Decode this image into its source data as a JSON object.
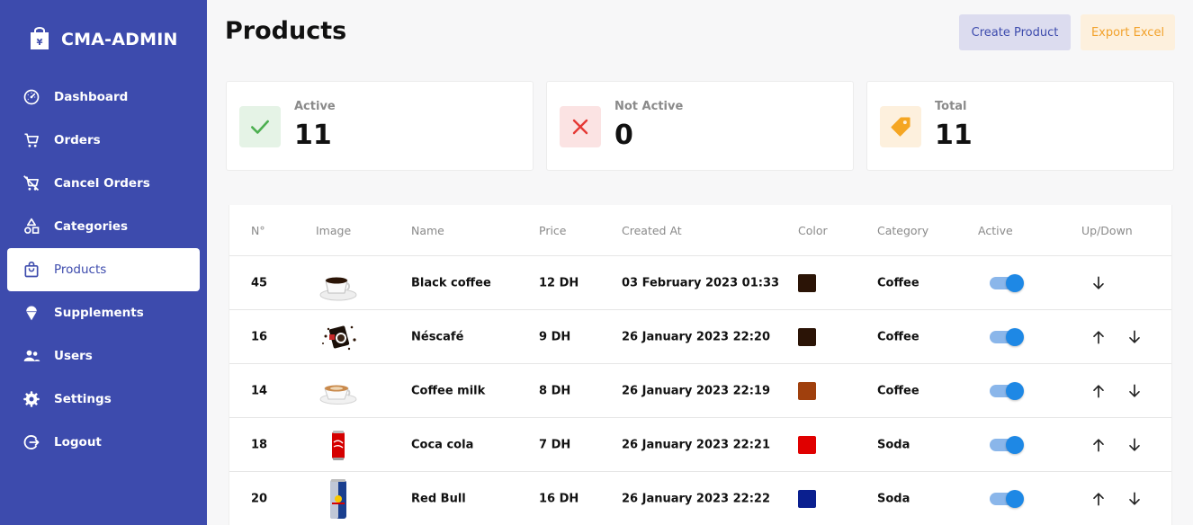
{
  "brand": {
    "name": "CMA-ADMIN",
    "logo_icon": "shopping-bag-yen-icon"
  },
  "sidebar": {
    "items": [
      {
        "label": "Dashboard",
        "icon": "speedometer-icon",
        "active": false
      },
      {
        "label": "Orders",
        "icon": "cart-icon",
        "active": false
      },
      {
        "label": "Cancel Orders",
        "icon": "cart-off-icon",
        "active": false
      },
      {
        "label": "Categories",
        "icon": "shapes-icon",
        "active": false
      },
      {
        "label": "Products",
        "icon": "shopping-bag-icon",
        "active": true
      },
      {
        "label": "Supplements",
        "icon": "ice-cream-icon",
        "active": false
      },
      {
        "label": "Users",
        "icon": "users-icon",
        "active": false
      },
      {
        "label": "Settings",
        "icon": "gear-icon",
        "active": false
      },
      {
        "label": "Logout",
        "icon": "logout-icon",
        "active": false
      }
    ]
  },
  "header": {
    "title": "Products",
    "create_label": "Create Product",
    "export_label": "Export Excel"
  },
  "stats": [
    {
      "label": "Active",
      "value": "11",
      "icon": "check-icon",
      "color": "#4caf50",
      "bg": "#e5f3e6"
    },
    {
      "label": "Not Active",
      "value": "0",
      "icon": "close-icon",
      "color": "#e53935",
      "bg": "#fbe3e3"
    },
    {
      "label": "Total",
      "value": "11",
      "icon": "price-tag-icon",
      "color": "#f5a623",
      "bg": "#fdf0dd"
    }
  ],
  "table": {
    "headers": [
      "N°",
      "Image",
      "Name",
      "Price",
      "Created At",
      "Color",
      "Category",
      "Active",
      "Up/Down"
    ],
    "rows": [
      {
        "no": "45",
        "image": "black-coffee-image",
        "name": "Black coffee",
        "price": "12 DH",
        "created": "03 February 2023 01:33",
        "color": "#2b1406",
        "category": "Coffee",
        "active": true,
        "up": false,
        "down": true
      },
      {
        "no": "16",
        "image": "nescafe-image",
        "name": "Néscafé",
        "price": "9 DH",
        "created": "26 January 2023 22:20",
        "color": "#2b1406",
        "category": "Coffee",
        "active": true,
        "up": true,
        "down": true
      },
      {
        "no": "14",
        "image": "coffee-milk-image",
        "name": "Coffee milk",
        "price": "8 DH",
        "created": "26 January 2023 22:19",
        "color": "#a0400d",
        "category": "Coffee",
        "active": true,
        "up": true,
        "down": true
      },
      {
        "no": "18",
        "image": "coca-cola-image",
        "name": "Coca cola",
        "price": "7 DH",
        "created": "26 January 2023 22:21",
        "color": "#e00000",
        "category": "Soda",
        "active": true,
        "up": true,
        "down": true
      },
      {
        "no": "20",
        "image": "red-bull-image",
        "name": "Red Bull",
        "price": "16 DH",
        "created": "26 January 2023 22:22",
        "color": "#0a1f8f",
        "category": "Soda",
        "active": true,
        "up": true,
        "down": true
      }
    ]
  },
  "colors": {
    "sidebar": "#3d4bad",
    "accent": "#1e88e5"
  }
}
